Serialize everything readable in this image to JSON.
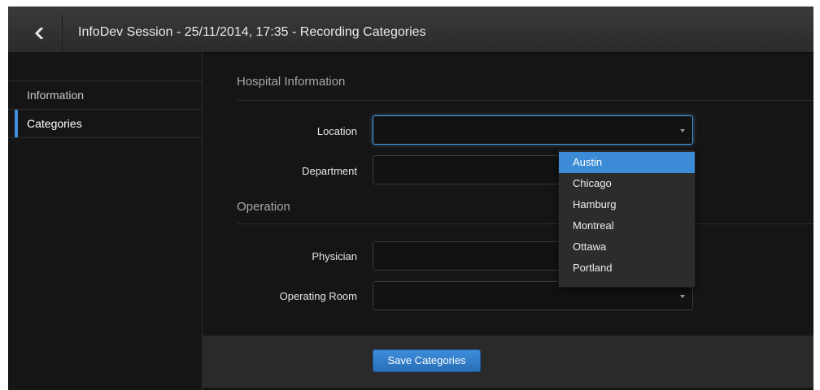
{
  "header": {
    "title": "InfoDev Session - 25/11/2014, 17:35 - Recording Categories",
    "back_icon": "chevron-left-icon"
  },
  "sidebar": {
    "items": [
      {
        "label": "Information",
        "active": false
      },
      {
        "label": "Categories",
        "active": true
      }
    ]
  },
  "sections": {
    "hospital": {
      "title": "Hospital Information",
      "location_label": "Location",
      "location_value": "",
      "department_label": "Department",
      "department_value": ""
    },
    "operation": {
      "title": "Operation",
      "physician_label": "Physician",
      "physician_value": "",
      "operating_room_label": "Operating Room",
      "operating_room_value": ""
    }
  },
  "location_dropdown": {
    "options": [
      "Austin",
      "Chicago",
      "Hamburg",
      "Montreal",
      "Ottawa",
      "Portland"
    ],
    "highlighted": "Austin"
  },
  "footer": {
    "save_label": "Save Categories"
  },
  "colors": {
    "accent": "#3b8bd6",
    "background": "#151515",
    "titlebar": "#2f2f2f"
  }
}
